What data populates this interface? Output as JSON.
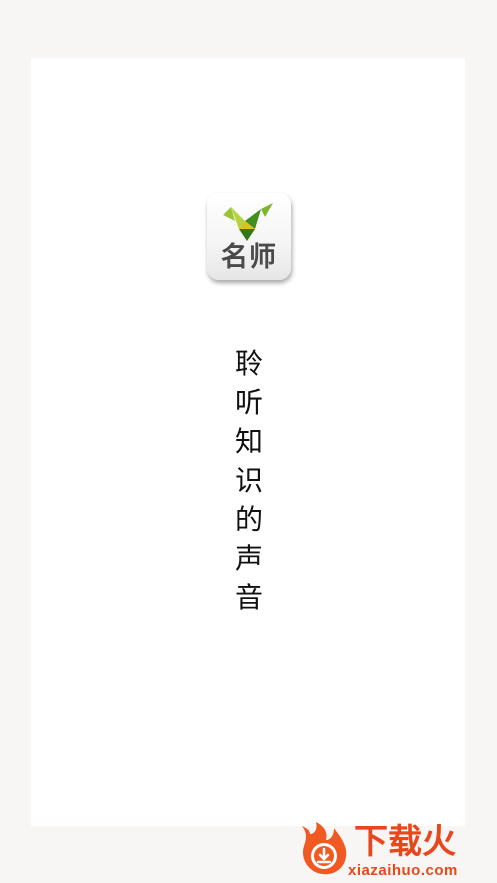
{
  "splash": {
    "app_icon_label": "名师",
    "slogan": "聆听知识的声音"
  },
  "watermark": {
    "title": "下载火",
    "url": "xiazaihuo.com"
  },
  "colors": {
    "background": "#f7f6f4",
    "screen": "#ffffff",
    "icon_green_dark": "#3f8f1f",
    "icon_green_light": "#9cc43a",
    "icon_yellow": "#d9c21f",
    "watermark_orange": "#e8471b"
  }
}
